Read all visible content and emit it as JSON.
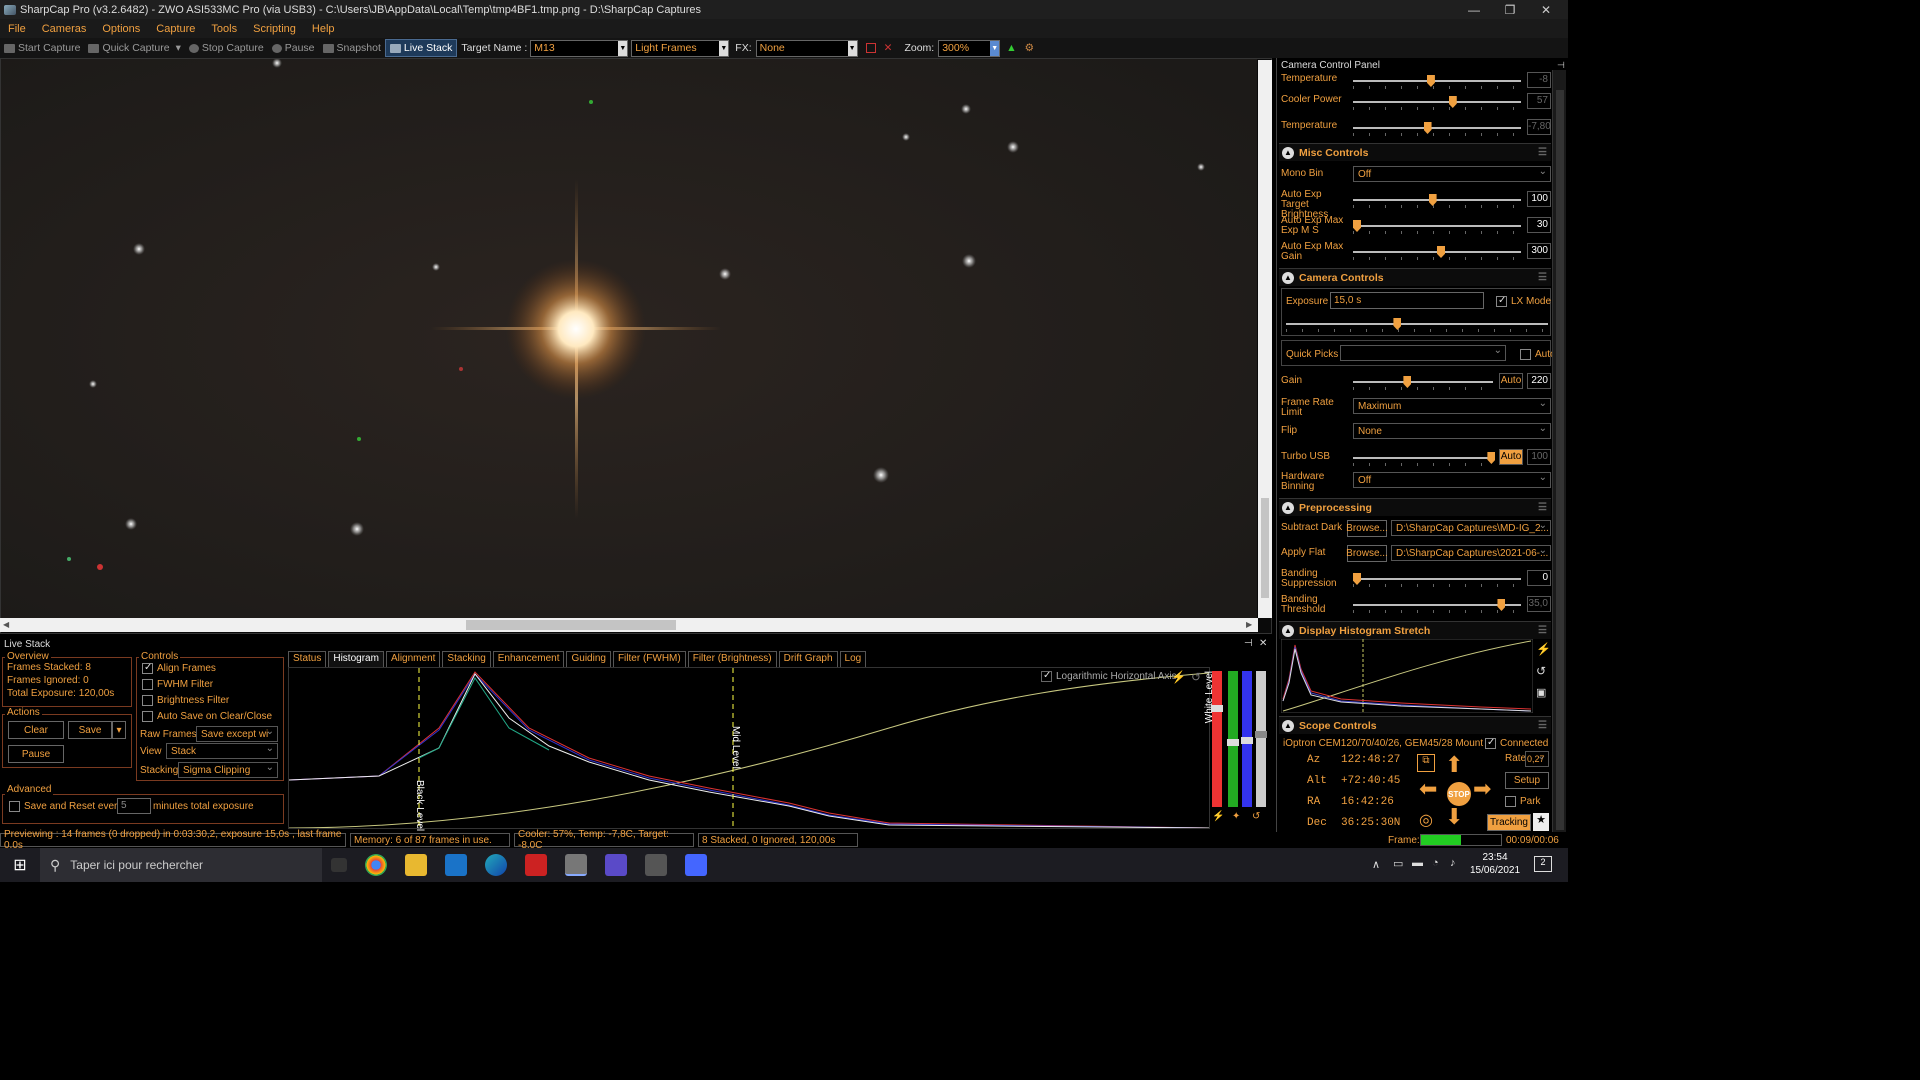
{
  "window": {
    "title": "SharpCap Pro (v3.2.6482) - ZWO ASI533MC Pro (via USB3) - C:\\Users\\JB\\AppData\\Local\\Temp\\tmp4BF1.tmp.png - D:\\SharpCap Captures"
  },
  "menu": [
    "File",
    "Cameras",
    "Options",
    "Capture",
    "Tools",
    "Scripting",
    "Help"
  ],
  "toolbar": {
    "start_capture": "Start Capture",
    "quick_capture": "Quick Capture",
    "stop_capture": "Stop Capture",
    "pause": "Pause",
    "snapshot": "Snapshot",
    "live_stack": "Live Stack",
    "target_name_label": "Target Name :",
    "target_name": "M13",
    "frame_type": "Light Frames",
    "fx_label": "FX:",
    "fx": "None",
    "zoom_label": "Zoom:",
    "zoom": "300%"
  },
  "right_panel": {
    "title": "Camera Control Panel",
    "top": [
      {
        "label": "Temperature",
        "value": "-8",
        "pos": 0.44
      },
      {
        "label": "Cooler Power",
        "value": "57",
        "pos": 0.57
      },
      {
        "label": "Temperature",
        "value": "-7,80",
        "pos": 0.42
      }
    ],
    "misc": {
      "header": "Misc Controls",
      "mono_bin_label": "Mono Bin",
      "mono_bin": "Off",
      "rows": [
        {
          "label": "Auto Exp Target Brightness",
          "value": "100",
          "pos": 0.45
        },
        {
          "label": "Auto Exp Max Exp M S",
          "value": "30",
          "pos": 0.0
        },
        {
          "label": "Auto Exp Max Gain",
          "value": "300",
          "pos": 0.5
        }
      ]
    },
    "camera": {
      "header": "Camera Controls",
      "exposure_label": "Exposure",
      "exposure": "15,0 s",
      "lx_mode": "LX Mode",
      "quick_picks_label": "Quick Picks",
      "auto_label": "Auto",
      "gain_label": "Gain",
      "gain_auto": "Auto",
      "gain": "220",
      "frame_rate_label": "Frame Rate Limit",
      "frame_rate": "Maximum",
      "flip_label": "Flip",
      "flip": "None",
      "turbo_label": "Turbo USB",
      "turbo_auto": "Auto",
      "turbo": "100",
      "hw_bin_label": "Hardware Binning",
      "hw_bin": "Off"
    },
    "pre": {
      "header": "Preprocessing",
      "dark_label": "Subtract Dark",
      "browse": "Browse...",
      "dark": "D:\\SharpCap Captures\\MD-IG_2...",
      "flat_label": "Apply Flat",
      "flat": "D:\\SharpCap Captures\\2021-06-...",
      "band_sup_label": "Banding Suppression",
      "band_sup": "0",
      "band_thr_label": "Banding Threshold",
      "band_thr": "35,0"
    },
    "hist": {
      "header": "Display Histogram Stretch"
    },
    "scope": {
      "header": "Scope Controls",
      "mount": "iOptron CEM120/70/40/26, GEM45/28 Mount",
      "connected": "Connected",
      "az_label": "Az",
      "az": "122:48:27",
      "alt_label": "Alt",
      "alt": "+72:40:45",
      "ra_label": "RA",
      "ra": "16:42:26",
      "dec_label": "Dec",
      "dec": "36:25:30N",
      "rate_label": "Rate:",
      "rate": "0,27",
      "setup": "Setup",
      "park": "Park",
      "tracking": "Tracking",
      "stop": "STOP"
    },
    "frame_label": "Frame:",
    "frame_time": "00:09/00:06"
  },
  "live_stack": {
    "title": "Live Stack",
    "overview_label": "Overview",
    "frames_stacked": "Frames Stacked:  8",
    "frames_ignored": "Frames Ignored:   0",
    "total_exposure": "Total Exposure:   120,00s",
    "actions_label": "Actions",
    "clear": "Clear",
    "save": "Save",
    "pause": "Pause",
    "controls_label": "Controls",
    "align": "Align Frames",
    "fwhm": "FWHM Filter",
    "bright": "Brightness Filter",
    "autosave": "Auto Save on Clear/Close",
    "raw_label": "Raw Frames",
    "raw": "Save except wi",
    "view_label": "View",
    "view": "Stack",
    "stacking_label": "Stacking",
    "stacking": "Sigma Clipping",
    "advanced_label": "Advanced",
    "save_reset": "Save and Reset every",
    "save_reset_value": "5",
    "save_reset_unit": "minutes total exposure",
    "tabs": [
      "Status",
      "Histogram",
      "Alignment",
      "Stacking",
      "Enhancement",
      "Guiding",
      "Filter (FWHM)",
      "Filter (Brightness)",
      "Drift Graph",
      "Log"
    ],
    "log_axis": "Logarithmic Horizontal Axis",
    "black_level": "Black Level",
    "mid_level": "Mid Level",
    "white_level": "White Level"
  },
  "status": {
    "preview": "Previewing : 14 frames (0 dropped) in 0:03:30,2, exposure 15,0s , last frame 0,0s",
    "memory": "Memory: 6 of 87 frames in use.",
    "cooler": "Cooler: 57%, Temp: -7,8C, Target: -8,0C",
    "stacked": "8 Stacked, 0 Ignored, 120,00s"
  },
  "taskbar": {
    "search": "Taper ici pour rechercher",
    "time": "23:54",
    "date": "15/06/2021",
    "notif": "2"
  }
}
